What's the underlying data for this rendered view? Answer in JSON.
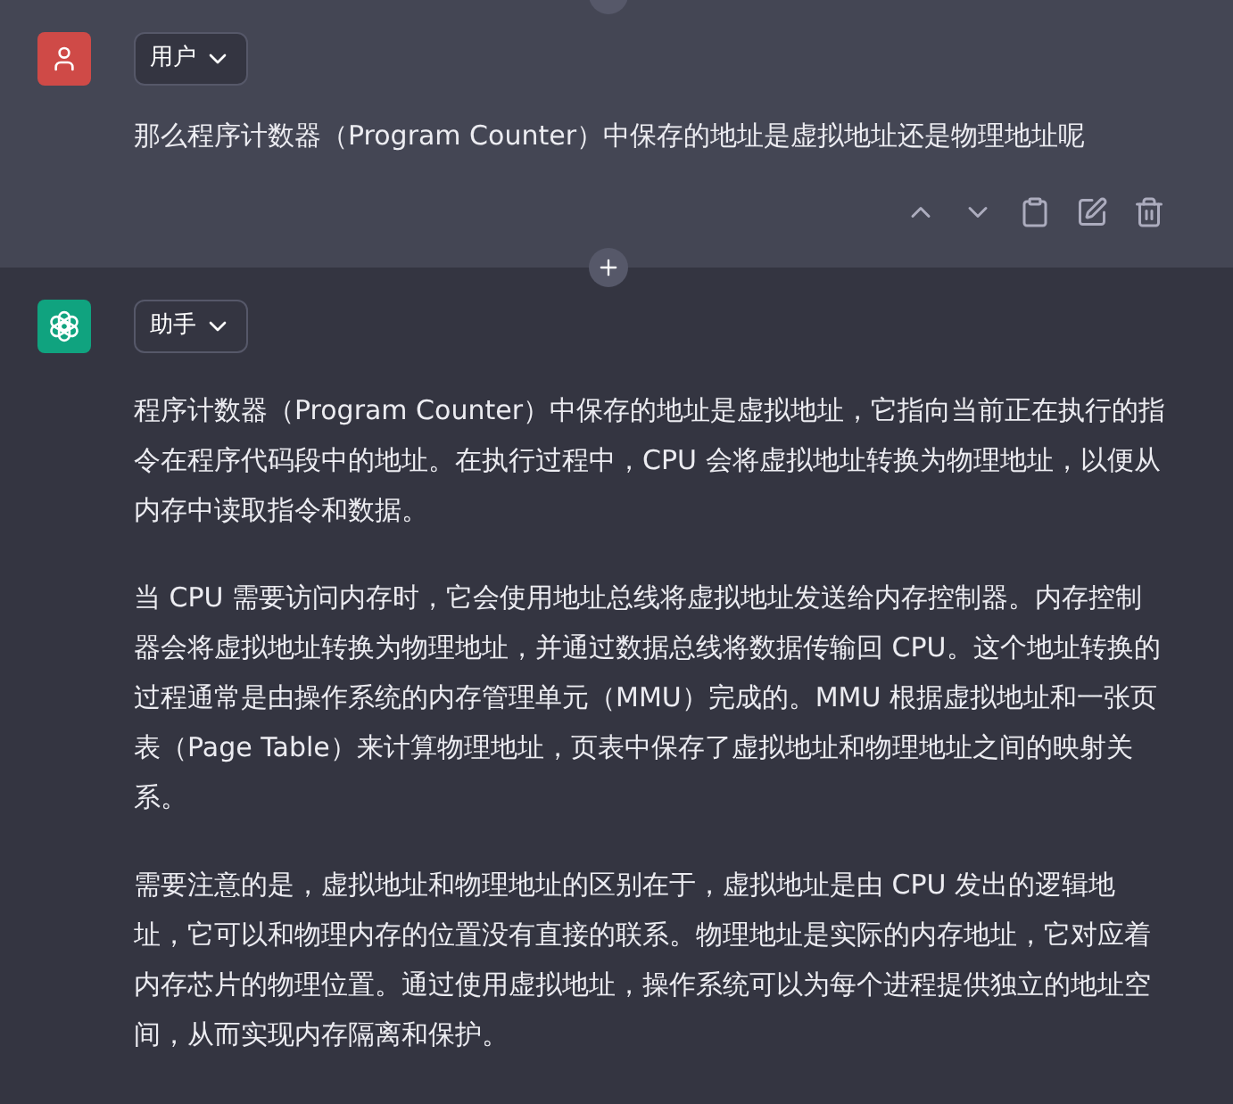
{
  "messages": [
    {
      "kind": "user",
      "role_label": "用户",
      "paragraphs": [
        "那么程序计数器（Program Counter）中保存的地址是虚拟地址还是物理地址呢"
      ],
      "actions": true
    },
    {
      "kind": "assistant",
      "role_label": "助手",
      "paragraphs": [
        "程序计数器（Program Counter）中保存的地址是虚拟地址，它指向当前正在执行的指令在程序代码段中的地址。在执行过程中，CPU 会将虚拟地址转换为物理地址，以便从内存中读取指令和数据。",
        "当 CPU 需要访问内存时，它会使用地址总线将虚拟地址发送给内存控制器。内存控制器会将虚拟地址转换为物理地址，并通过数据总线将数据传输回 CPU。这个地址转换的过程通常是由操作系统的内存管理单元（MMU）完成的。MMU 根据虚拟地址和一张页表（Page Table）来计算物理地址，页表中保存了虚拟地址和物理地址之间的映射关系。",
        "需要注意的是，虚拟地址和物理地址的区别在于，虚拟地址是由 CPU 发出的逻辑地址，它可以和物理内存的位置没有直接的联系。物理地址是实际的内存地址，它对应着内存芯片的物理位置。通过使用虚拟地址，操作系统可以为每个进程提供独立的地址空间，从而实现内存隔离和保护。"
      ],
      "actions": false
    }
  ]
}
